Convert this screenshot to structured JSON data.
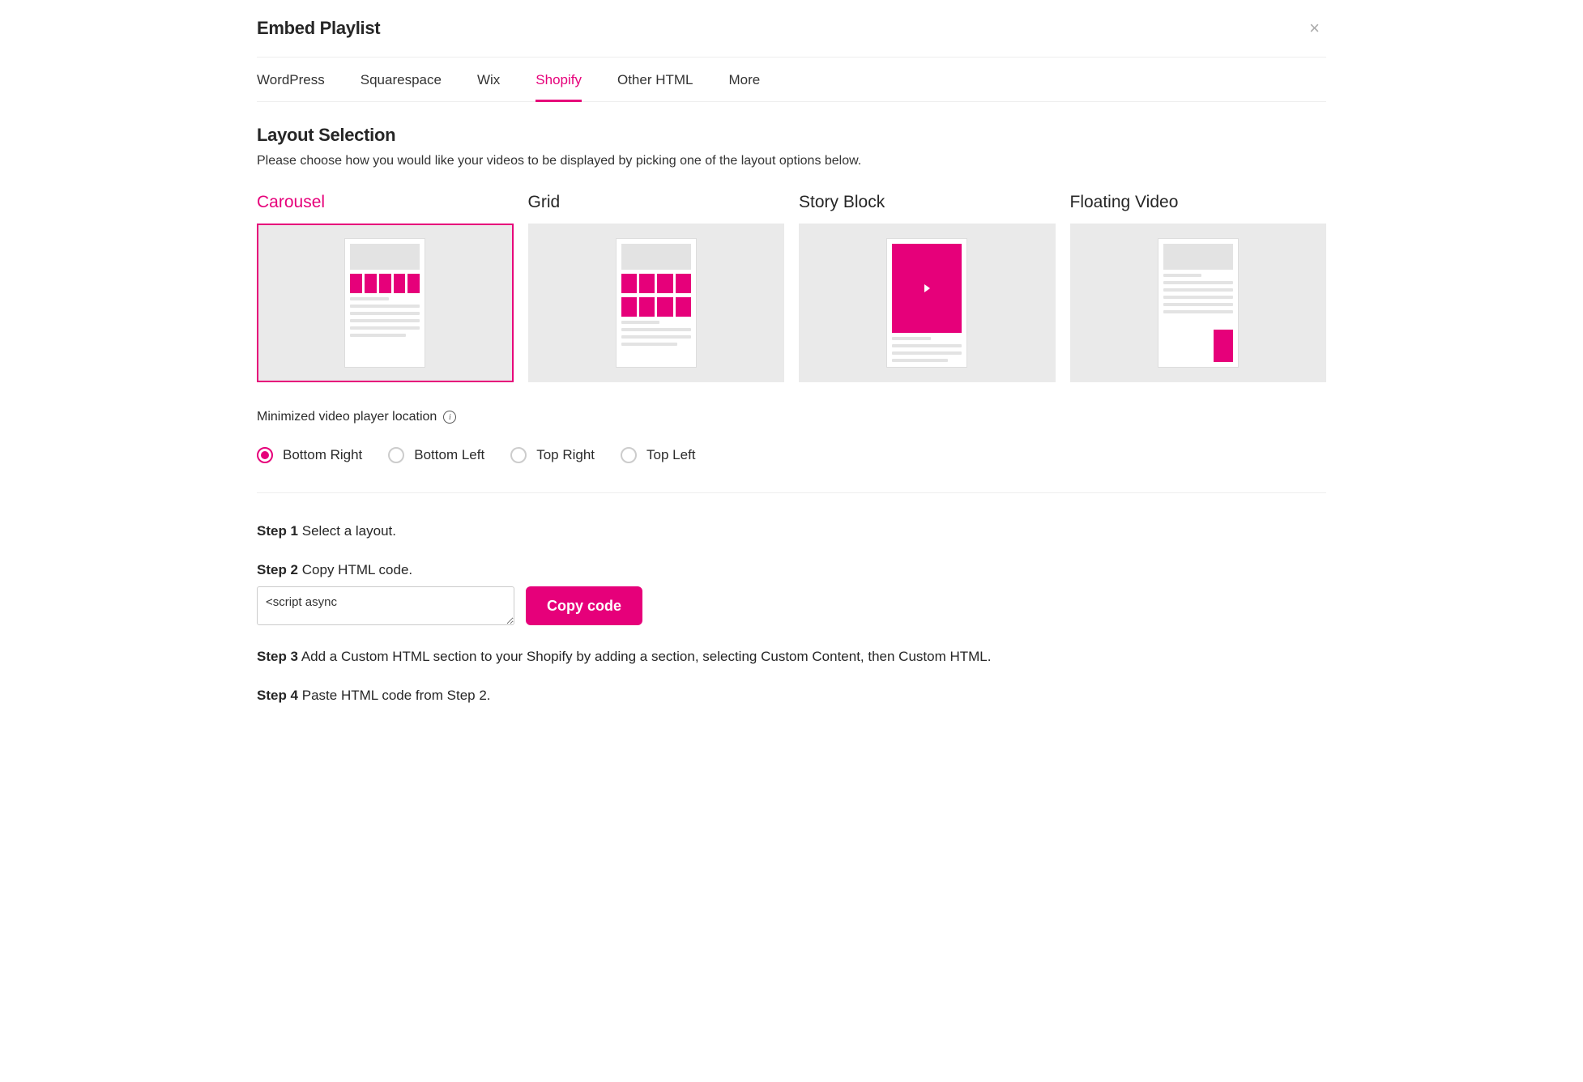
{
  "header": {
    "title": "Embed Playlist"
  },
  "tabs": [
    {
      "label": "WordPress",
      "active": false
    },
    {
      "label": "Squarespace",
      "active": false
    },
    {
      "label": "Wix",
      "active": false
    },
    {
      "label": "Shopify",
      "active": true
    },
    {
      "label": "Other HTML",
      "active": false
    },
    {
      "label": "More",
      "active": false
    }
  ],
  "layout_section": {
    "heading": "Layout Selection",
    "description": "Please choose how you would like your videos to be displayed by picking one of the layout options below."
  },
  "layouts": [
    {
      "label": "Carousel",
      "active": true
    },
    {
      "label": "Grid",
      "active": false
    },
    {
      "label": "Story Block",
      "active": false
    },
    {
      "label": "Floating Video",
      "active": false
    }
  ],
  "player_location": {
    "label": "Minimized video player location",
    "options": [
      {
        "label": "Bottom Right",
        "selected": true
      },
      {
        "label": "Bottom Left",
        "selected": false
      },
      {
        "label": "Top Right",
        "selected": false
      },
      {
        "label": "Top Left",
        "selected": false
      }
    ]
  },
  "steps": {
    "s1": {
      "label": "Step 1",
      "text": " Select a layout."
    },
    "s2": {
      "label": "Step 2",
      "text": " Copy HTML code."
    },
    "s3": {
      "label": "Step 3",
      "text": " Add a Custom HTML section to your Shopify by adding a section, selecting Custom Content, then Custom HTML."
    },
    "s4": {
      "label": "Step 4",
      "text": " Paste HTML code from Step 2."
    }
  },
  "code": {
    "snippet": "<script async",
    "copy_label": "Copy code"
  }
}
